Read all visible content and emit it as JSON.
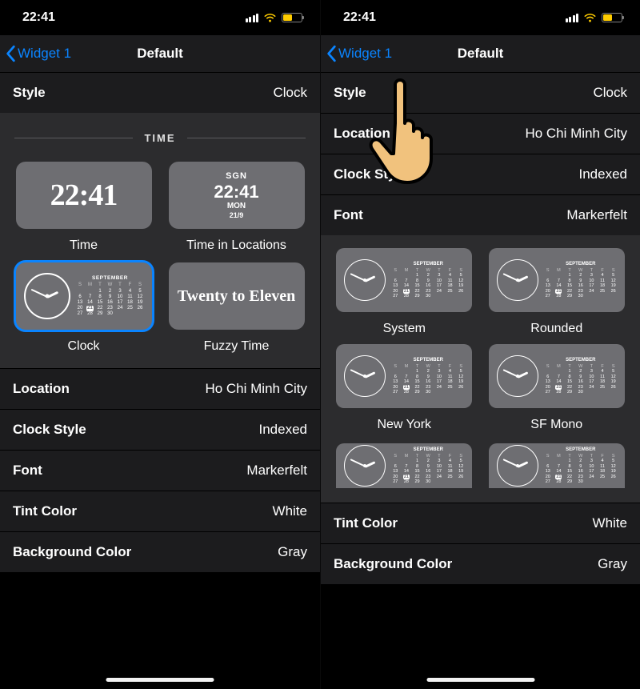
{
  "status": {
    "time": "22:41"
  },
  "navbar": {
    "back_label": "Widget 1",
    "title": "Default"
  },
  "rows": {
    "style": {
      "label": "Style",
      "value": "Clock"
    },
    "location": {
      "label": "Location",
      "value": "Ho Chi Minh City"
    },
    "clock_style": {
      "label": "Clock Style",
      "value": "Indexed"
    },
    "font": {
      "label": "Font",
      "value": "Markerfelt"
    },
    "tint_color": {
      "label": "Tint Color",
      "value": "White"
    },
    "background_color": {
      "label": "Background Color",
      "value": "Gray"
    }
  },
  "style_picker": {
    "section_title": "TIME",
    "options": {
      "time": {
        "label": "Time",
        "preview_time": "22:41"
      },
      "time_in_loc": {
        "label": "Time in Locations",
        "code": "SGN",
        "time": "22:41",
        "day": "MON",
        "date": "21/9"
      },
      "clock": {
        "label": "Clock",
        "cal_month": "SEPTEMBER"
      },
      "fuzzy": {
        "label": "Fuzzy Time",
        "text": "Twenty to Eleven"
      }
    }
  },
  "font_picker": {
    "options": {
      "system": {
        "label": "System",
        "cal_month": "SEPTEMBER"
      },
      "rounded": {
        "label": "Rounded",
        "cal_month": "SEPTEMBER"
      },
      "newyork": {
        "label": "New York",
        "cal_month": "SEPTEMBER"
      },
      "sfmono": {
        "label": "SF Mono",
        "cal_month": "SEPTEMBER"
      }
    }
  },
  "right": {
    "rows": {
      "style": {
        "label": "Style",
        "value": "Clock"
      },
      "location": {
        "label": "Location",
        "value": "Ho Chi Minh City"
      },
      "clock_style": {
        "label": "Clock Style",
        "value": "Indexed"
      },
      "font": {
        "label": "Font",
        "value": "Markerfelt"
      },
      "tint_color": {
        "label": "Tint Color",
        "value": "White"
      },
      "background_color": {
        "label": "Background Color",
        "value": "Gray"
      }
    }
  },
  "calendar": {
    "weekdays": [
      "S",
      "M",
      "T",
      "W",
      "T",
      "F",
      "S"
    ],
    "weeks": [
      [
        "",
        "",
        "1",
        "2",
        "3",
        "4",
        "5"
      ],
      [
        "6",
        "7",
        "8",
        "9",
        "10",
        "11",
        "12"
      ],
      [
        "13",
        "14",
        "15",
        "16",
        "17",
        "18",
        "19"
      ],
      [
        "20",
        "21",
        "22",
        "23",
        "24",
        "25",
        "26"
      ],
      [
        "27",
        "28",
        "29",
        "30",
        "",
        "",
        ""
      ]
    ],
    "today": "21"
  }
}
